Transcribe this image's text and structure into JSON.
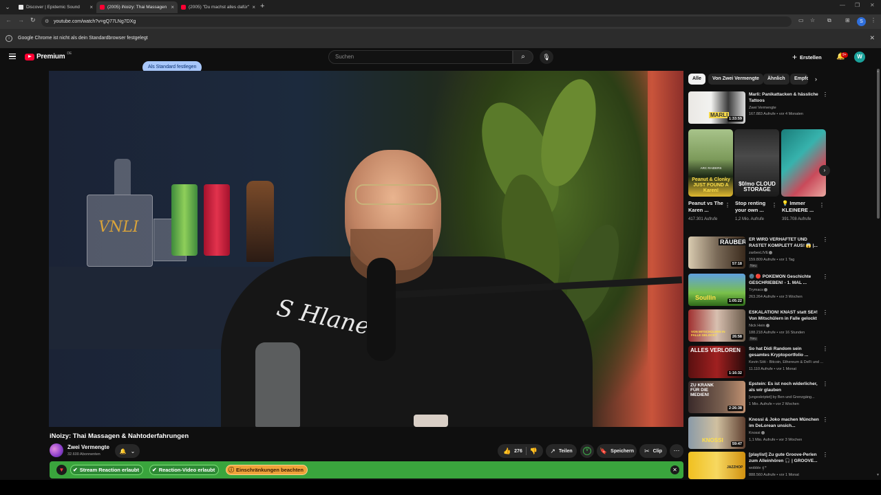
{
  "browser": {
    "tabs": [
      {
        "title": "Discover | Epidemic Sound",
        "active": false
      },
      {
        "title": "(2005) iNoizy: Thai Massagen &",
        "active": true
      },
      {
        "title": "(2005) \"Du machst alles dafür\"",
        "active": false
      }
    ],
    "new_tab": "+",
    "url": "youtube.com/watch?v=gQ77LNg7DXg",
    "profile_initial": "S",
    "infobar_message": "Google Chrome ist nicht als dein Standardbrowser festgelegt",
    "infobar_button": "Als Standard festlegen"
  },
  "masthead": {
    "logo_text": "Premium",
    "logo_region": "DE",
    "search_placeholder": "Suchen",
    "create_label": "Erstellen",
    "notification_badge": "9+",
    "avatar_initial": "W"
  },
  "video": {
    "title": "iNoizy: Thai Massagen & Nahtoderfahrungen",
    "channel": "Zwei Vermengte",
    "subscribers": "32.600 Abonnenten",
    "likes": "276",
    "share_label": "Teilen",
    "save_label": "Speichern",
    "clip_label": "Clip",
    "scene_text": {
      "decanter": "VNLI",
      "hoodie": "S Hlanet"
    }
  },
  "extension_banner": {
    "tag1": "Stream Reaction erlaubt",
    "tag2": "Reaction-Video erlaubt",
    "tag3": "Einschränkungen beachten"
  },
  "sidebar": {
    "chips": [
      "Alle",
      "Von Zwei Vermengte",
      "Ähnlich",
      "Empfo"
    ],
    "recommendations_top": [
      {
        "title": "Marli: Panikattacken & hässliche Tattoos",
        "channel": "Zwei Vermengte",
        "meta": "167.883 Aufrufe • vor 4 Monaten",
        "duration": "1:33:59",
        "badge": "",
        "thumb_text": "MARLI"
      }
    ],
    "shorts": [
      {
        "title": "Peanut vs The Karen ...",
        "views": "417.301 Aufrufe",
        "overlay": "Peanut & Clonky JUST FOUND A Karen!",
        "sub": "ARC RAIDERS"
      },
      {
        "title": "Stop renting your own ...",
        "views": "1,2 Mio. Aufrufe",
        "overlay": "$0/mo CLOUD STORAGE",
        "sub": ""
      },
      {
        "title": "💡 Immer KLEINERE ...",
        "views": "391.708 Aufrufe",
        "overlay": "",
        "sub": ""
      }
    ],
    "recommendations": [
      {
        "title": "ER WIRD VERHAFTET UND RASTET KOMPLETT AUS! 😱 |...",
        "channel": "zarbexLIVE",
        "verified": true,
        "meta": "159.809 Aufrufe • vor 1 Tag",
        "duration": "57:18",
        "badge": "Neu",
        "thumb_text": "RÄUBER"
      },
      {
        "title": "🌚 🔴 POKEMON Geschichte GESCHRIEBEN! - 1. MAL ...",
        "channel": "Trymacs",
        "verified": true,
        "meta": "263.264 Aufrufe • vor 3 Wochen",
        "duration": "1:05:22",
        "badge": "",
        "thumb_text": "Soullin"
      },
      {
        "title": "ESKALATION! KNAST statt SE#! Von Mitschülern in Falle gelockt",
        "channel": "Nick Hein",
        "verified": true,
        "meta": "188.218 Aufrufe • vor 16 Stunden",
        "duration": "26:58",
        "badge": "Neu",
        "thumb_text": "VON MITSCHÜLERN IN FALLE GELOCKT"
      },
      {
        "title": "So hat Didi Random sein gesamtes Krypto­portfolio ...",
        "channel": "Kevin Söti - Bitcoin, Ethereum & DeFi und ...",
        "verified": false,
        "meta": "11.110 Aufrufe • vor 1 Monat",
        "duration": "1:16:32",
        "badge": "",
        "thumb_text": "ALLES VERLOREN"
      },
      {
        "title": "Epstein: Es ist noch widerlicher, als wir glauben",
        "channel": "[ungeskriptet] by Ben  und Grenzgäng...",
        "verified": true,
        "meta": "1 Mio. Aufrufe • vor 2 Wochen",
        "duration": "2:26:38",
        "badge": "",
        "thumb_text": "ZU KRANK FÜR DIE MEDIEN!"
      },
      {
        "title": "Knossi & Joko machen München im DeLorean unsich...",
        "channel": "Knossi",
        "verified": true,
        "meta": "1,1 Mio. Aufrufe • vor 3 Wochen",
        "duration": "59:47",
        "badge": "",
        "thumb_text": "KNOSSI"
      },
      {
        "title": "[playlist] Zu gute Groove-Perlen zum Alleinhören 🎧 | GROOVE...",
        "channel": "wobble 𝄞𝄢",
        "verified": false,
        "meta": "888.560 Aufrufe • vor 1 Monat",
        "duration": "",
        "badge": "",
        "thumb_text": "JAZZHOP"
      }
    ]
  },
  "colors": {
    "background": "#0f0f0f",
    "brand_red": "#ff0033",
    "banner_green": "#3aa53d",
    "warn_orange": "#f0a33a",
    "chip_active": "#f1f1f1"
  }
}
